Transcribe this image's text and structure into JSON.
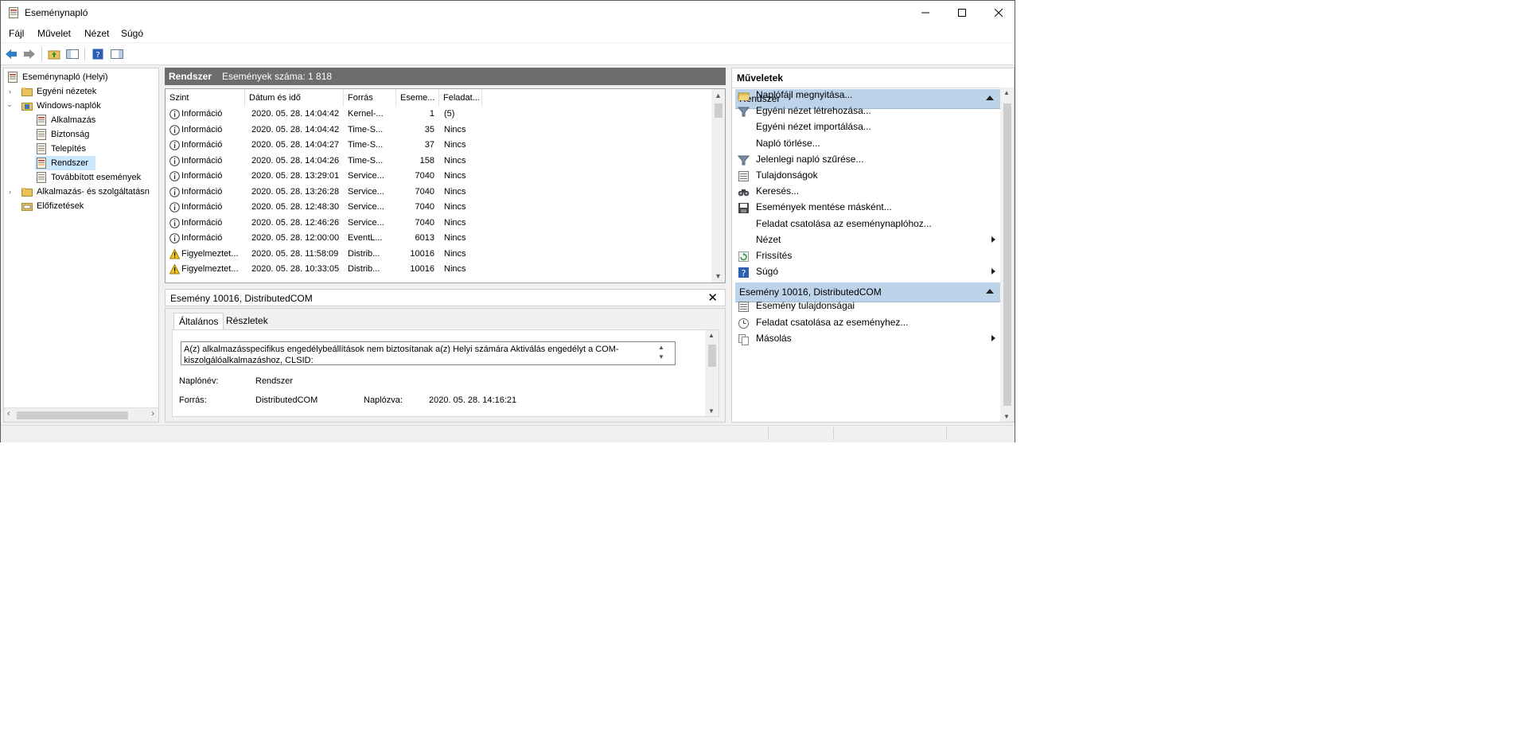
{
  "window": {
    "title": "Eseménynapló"
  },
  "menu": [
    "Fájl",
    "Művelet",
    "Nézet",
    "Súgó"
  ],
  "tree": [
    {
      "label": "Eseménynapló (Helyi)",
      "icon": "event-viewer-icon"
    },
    {
      "label": "Egyéni nézetek",
      "icon": "folder-icon"
    },
    {
      "label": "Windows-naplók",
      "icon": "windows-logs-icon"
    },
    {
      "label": "Alkalmazás",
      "icon": "log-icon"
    },
    {
      "label": "Biztonság",
      "icon": "log-icon"
    },
    {
      "label": "Telepítés",
      "icon": "log-icon"
    },
    {
      "label": "Rendszer",
      "icon": "log-icon",
      "selected": true
    },
    {
      "label": "Továbbított események",
      "icon": "log-icon"
    },
    {
      "label": "Alkalmazás- és szolgáltatásn",
      "icon": "folder-icon"
    },
    {
      "label": "Előfizetések",
      "icon": "subscriptions-icon"
    }
  ],
  "center": {
    "title": "Rendszer",
    "count": "Események száma: 1 818"
  },
  "columns": [
    "Szint",
    "Dátum és idő",
    "Forrás",
    "Eseme...",
    "Feladat..."
  ],
  "events": [
    {
      "level": "Információ",
      "date": "2020. 05. 28. 14:04:42",
      "source": "Kernel-...",
      "id": "1",
      "task": "(5)",
      "type": "info"
    },
    {
      "level": "Információ",
      "date": "2020. 05. 28. 14:04:42",
      "source": "Time-S...",
      "id": "35",
      "task": "Nincs",
      "type": "info"
    },
    {
      "level": "Információ",
      "date": "2020. 05. 28. 14:04:27",
      "source": "Time-S...",
      "id": "37",
      "task": "Nincs",
      "type": "info"
    },
    {
      "level": "Információ",
      "date": "2020. 05. 28. 14:04:26",
      "source": "Time-S...",
      "id": "158",
      "task": "Nincs",
      "type": "info"
    },
    {
      "level": "Információ",
      "date": "2020. 05. 28. 13:29:01",
      "source": "Service...",
      "id": "7040",
      "task": "Nincs",
      "type": "info"
    },
    {
      "level": "Információ",
      "date": "2020. 05. 28. 13:26:28",
      "source": "Service...",
      "id": "7040",
      "task": "Nincs",
      "type": "info"
    },
    {
      "level": "Információ",
      "date": "2020. 05. 28. 12:48:30",
      "source": "Service...",
      "id": "7040",
      "task": "Nincs",
      "type": "info"
    },
    {
      "level": "Információ",
      "date": "2020. 05. 28. 12:46:26",
      "source": "Service...",
      "id": "7040",
      "task": "Nincs",
      "type": "info"
    },
    {
      "level": "Információ",
      "date": "2020. 05. 28. 12:00:00",
      "source": "EventL...",
      "id": "6013",
      "task": "Nincs",
      "type": "info"
    },
    {
      "level": "Figyelmeztet...",
      "date": "2020. 05. 28. 11:58:09",
      "source": "Distrib...",
      "id": "10016",
      "task": "Nincs",
      "type": "warning"
    },
    {
      "level": "Figyelmeztet...",
      "date": "2020. 05. 28. 10:33:05",
      "source": "Distrib...",
      "id": "10016",
      "task": "Nincs",
      "type": "warning"
    }
  ],
  "detail": {
    "title": "Esemény 10016, DistributedCOM",
    "tabs": [
      "Általános",
      "Részletek"
    ],
    "message": "A(z) alkalmazásspecifikus engedélybeállítások nem biztosítanak a(z) Helyi számára Aktiválás engedélyt a COM-kiszolgálóalkalmazáshoz, CLSID:",
    "log_name_label": "Naplónév:",
    "log_name": "Rendszer",
    "source_label": "Forrás:",
    "source": "DistributedCOM",
    "logged_label": "Naplózva:",
    "logged": "2020. 05. 28. 14:16:21"
  },
  "actions": {
    "title": "Műveletek",
    "section1": "Rendszer",
    "items1": [
      {
        "label": "Naplófájl megnyitása...",
        "icon": "open-folder-icon",
        "submenu": false
      },
      {
        "label": "Egyéni nézet létrehozása...",
        "icon": "filter-icon",
        "submenu": false
      },
      {
        "label": "Egyéni nézet importálása...",
        "icon": "",
        "submenu": false
      },
      {
        "label": "Napló törlése...",
        "icon": "",
        "submenu": false
      },
      {
        "label": "Jelenlegi napló szűrése...",
        "icon": "filter-icon",
        "submenu": false
      },
      {
        "label": "Tulajdonságok",
        "icon": "properties-icon",
        "submenu": false
      },
      {
        "label": "Keresés...",
        "icon": "binoculars-icon",
        "submenu": false
      },
      {
        "label": "Események mentése másként...",
        "icon": "save-icon",
        "submenu": false
      },
      {
        "label": "Feladat csatolása az eseménynaplóhoz...",
        "icon": "",
        "submenu": false
      },
      {
        "label": "Nézet",
        "icon": "",
        "submenu": true
      },
      {
        "label": "Frissítés",
        "icon": "refresh-icon",
        "submenu": false
      },
      {
        "label": "Súgó",
        "icon": "help-icon",
        "submenu": true
      }
    ],
    "section2": "Esemény 10016, DistributedCOM",
    "items2": [
      {
        "label": "Esemény tulajdonságai",
        "icon": "properties-icon",
        "submenu": false
      },
      {
        "label": "Feladat csatolása az eseményhez...",
        "icon": "task-icon",
        "submenu": false
      },
      {
        "label": "Másolás",
        "icon": "copy-icon",
        "submenu": true
      }
    ]
  }
}
